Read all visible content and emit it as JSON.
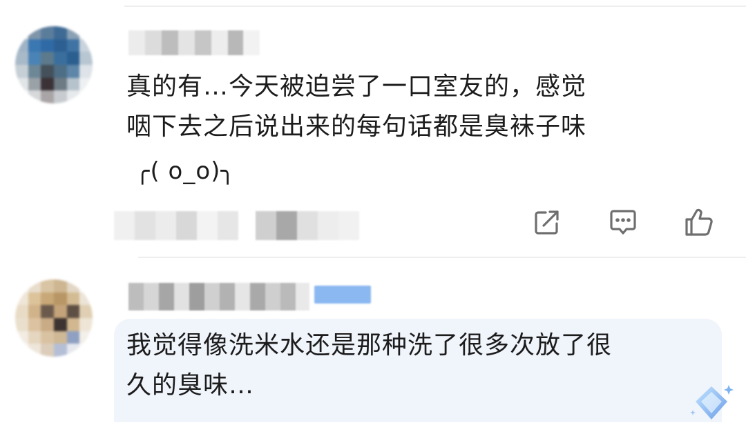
{
  "comments": [
    {
      "text": "真的有…今天被迫尝了一口室友的，感觉\n咽下去之后说出来的每句话都是臭袜子味",
      "kaomoji": "╭( o_o)╮",
      "actions": [
        "share-icon",
        "reply-icon",
        "like-icon"
      ]
    },
    {
      "text": "我觉得像洗米水还是那种洗了很多次放了很\n久的臭味…"
    }
  ],
  "colors": {
    "text": "#1c1c1c",
    "icon": "#6e6e6e",
    "divider": "#eeeeee",
    "reply_bubble": "#f0f4fb",
    "badge": "#8bb8f0"
  }
}
